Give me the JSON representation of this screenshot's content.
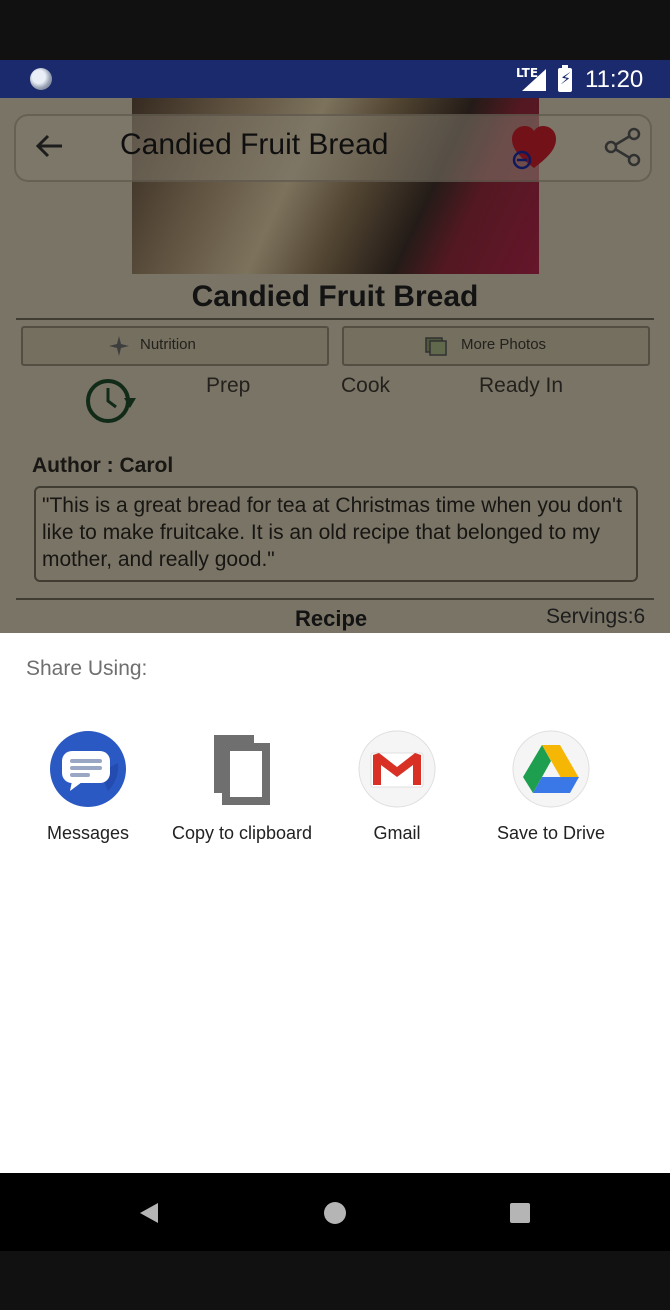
{
  "status_bar": {
    "network": "LTE",
    "time": "11:20"
  },
  "app": {
    "toolbar_title": "Candied Fruit Bread",
    "recipe_title": "Candied Fruit Bread",
    "buttons": {
      "nutrition": "Nutrition",
      "more_photos": "More Photos"
    },
    "times": {
      "prep": "Prep",
      "cook": "Cook",
      "ready_in": "Ready In"
    },
    "author": "Author : Carol",
    "description": "\"This is a great bread for tea at Christmas time when you don't like to make fruitcake.  It is an old recipe that belonged to my mother, and really good.\"",
    "recipe_heading": "Recipe",
    "servings": "Servings:6"
  },
  "share_sheet": {
    "title": "Share Using:",
    "targets": [
      {
        "label": "Messages",
        "icon": "messages-icon"
      },
      {
        "label": "Copy to clipboard",
        "icon": "copy-icon"
      },
      {
        "label": "Gmail",
        "icon": "gmail-icon"
      },
      {
        "label": "Save to Drive",
        "icon": "drive-icon"
      }
    ]
  },
  "nav_bar": {
    "back": "back-icon",
    "home": "home-icon",
    "recents": "recents-icon"
  },
  "colors": {
    "status_bar": "#1a2a6c",
    "app_bg": "#d2c9b0",
    "messages_blue": "#2b59c3"
  }
}
